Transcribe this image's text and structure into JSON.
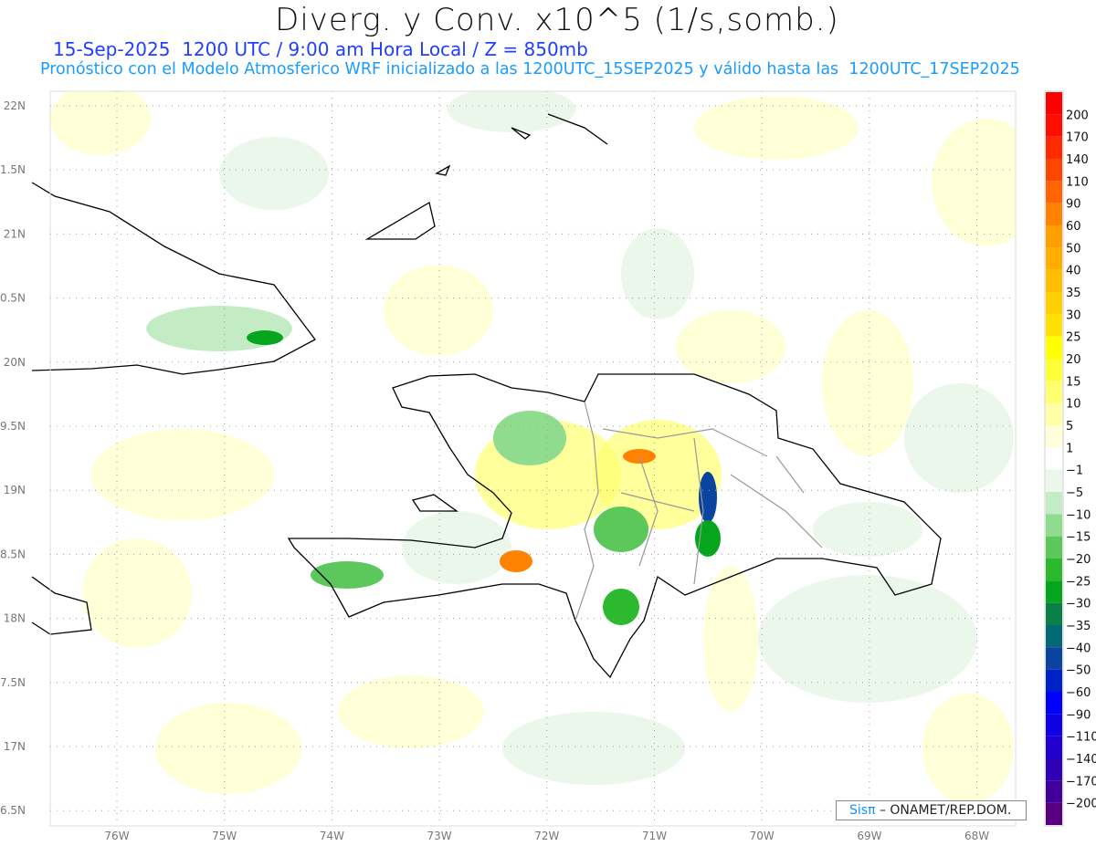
{
  "title": "Diverg. y Conv. x10^5 (1/s,somb.)",
  "subtitle_time": "15-Sep-2025  1200 UTC / 9:00 am Hora Local / Z = 850mb",
  "subtitle_model": "Pronóstico con el Modelo Atmosferico WRF inicializado a las 1200UTC_15SEP2025 y válido hasta las  1200UTC_17SEP2025",
  "credit": {
    "brand": "Sisπ",
    "text": " – ONAMET/REP.DOM."
  },
  "axes": {
    "lon_labels": [
      "76W",
      "75W",
      "74W",
      "73W",
      "72W",
      "71W",
      "70W",
      "69W",
      "68W"
    ],
    "lat_labels": [
      "22N",
      "1.5N",
      "21N",
      "0.5N",
      "20N",
      "9.5N",
      "19N",
      "8.5N",
      "18N",
      "7.5N",
      "17N",
      "6.5N"
    ]
  },
  "colorbar": {
    "labels": [
      "200",
      "170",
      "140",
      "110",
      "90",
      "60",
      "50",
      "40",
      "35",
      "30",
      "25",
      "20",
      "15",
      "10",
      "5",
      "1",
      "-1",
      "-5",
      "-10",
      "-15",
      "-20",
      "-25",
      "-30",
      "-35",
      "-40",
      "-50",
      "-60",
      "-90",
      "-110",
      "-140",
      "-170",
      "-200"
    ],
    "colors": [
      "#ff0000",
      "#ff0d00",
      "#ff2a00",
      "#ff4600",
      "#ff6400",
      "#ff8200",
      "#ffa000",
      "#ffae00",
      "#ffbf00",
      "#ffd000",
      "#ffe000",
      "#ffff00",
      "#ffff38",
      "#ffff70",
      "#ffffa6",
      "#ffffd8",
      "#ffffff",
      "#eaf7ea",
      "#c4ecc4",
      "#8fdc8f",
      "#5cc85c",
      "#2db92d",
      "#05a51e",
      "#0a7f48",
      "#056876",
      "#0a44a0",
      "#0020c8",
      "#0000ff",
      "#1000e6",
      "#2000d0",
      "#3000b6",
      "#42009a",
      "#580080"
    ]
  }
}
